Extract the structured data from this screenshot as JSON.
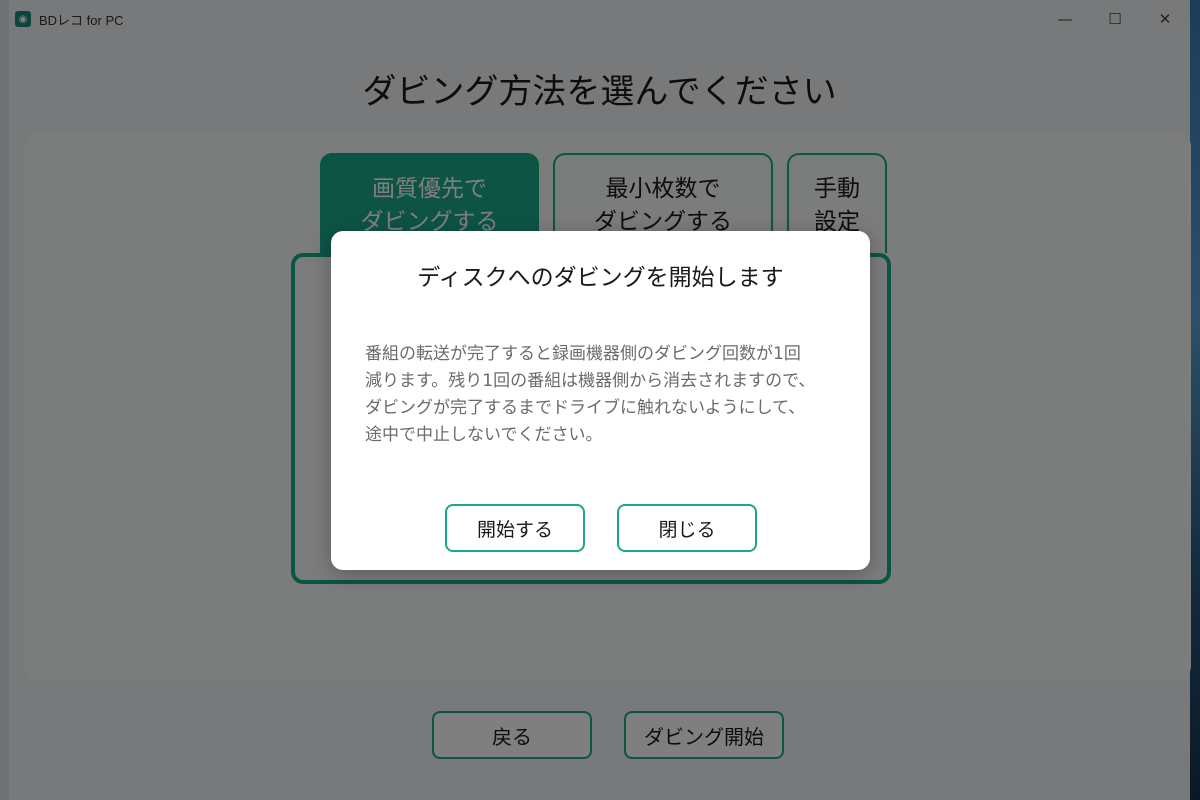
{
  "window": {
    "title": "BDレコ for PC",
    "controls": {
      "minimize": "—",
      "maximize": "☐",
      "close": "✕"
    }
  },
  "page": {
    "heading": "ダビング方法を選んでください"
  },
  "tabs": [
    {
      "label": "画質優先で\nダビングする",
      "active": true
    },
    {
      "label": "最小枚数で\nダビングする",
      "active": false
    },
    {
      "label": "手動\n設定",
      "active": false
    }
  ],
  "bottom_buttons": {
    "back": "戻る",
    "start_dubbing": "ダビング開始"
  },
  "dialog": {
    "title": "ディスクへのダビングを開始します",
    "message": "番組の転送が完了すると録画機器側のダビング回数が1回\n減ります。残り1回の番組は機器側から消去されますので、\nダビングが完了するまでドライブに触れないようにして、\n途中で中止しないでください。",
    "start_button": "開始する",
    "close_button": "閉じる"
  },
  "colors": {
    "accent": "#1aa88a",
    "overlay": "rgba(0,0,0,0.5)"
  }
}
